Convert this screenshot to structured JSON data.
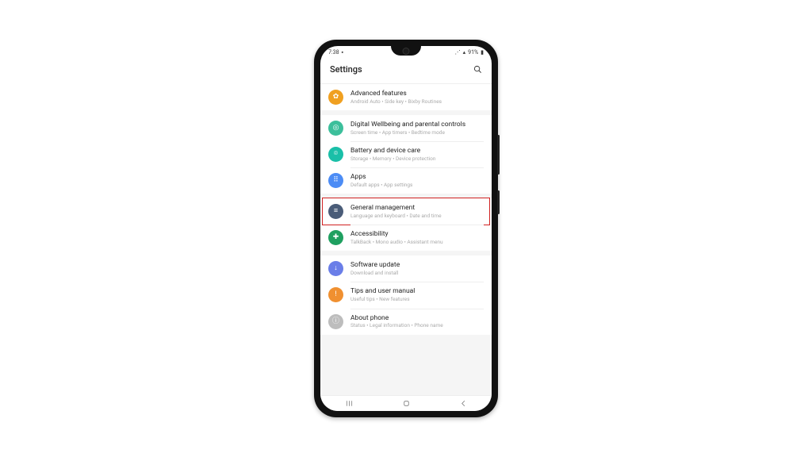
{
  "status": {
    "time": "7:38",
    "battery": "91%"
  },
  "header": {
    "title": "Settings"
  },
  "groups": [
    {
      "items": [
        {
          "title": "Advanced features",
          "subtitle": "Android Auto  •  Side key  •  Bixby Routines",
          "iconColor": "#f0a020",
          "iconGlyph": "✿"
        }
      ]
    },
    {
      "items": [
        {
          "title": "Digital Wellbeing and parental controls",
          "subtitle": "Screen time  •  App timers  •  Bedtime mode",
          "iconColor": "#3cbf9b",
          "iconGlyph": "◎"
        },
        {
          "title": "Battery and device care",
          "subtitle": "Storage  •  Memory  •  Device protection",
          "iconColor": "#1abfa8",
          "iconGlyph": "⌾"
        },
        {
          "title": "Apps",
          "subtitle": "Default apps  •  App settings",
          "iconColor": "#4c8cf5",
          "iconGlyph": "⠿"
        }
      ]
    },
    {
      "items": [
        {
          "title": "General management",
          "subtitle": "Language and keyboard  •  Date and time",
          "iconColor": "#4a5c78",
          "iconGlyph": "≡",
          "highlight": true
        },
        {
          "title": "Accessibility",
          "subtitle": "TalkBack  •  Mono audio  •  Assistant menu",
          "iconColor": "#1fa060",
          "iconGlyph": "✚"
        }
      ]
    },
    {
      "items": [
        {
          "title": "Software update",
          "subtitle": "Download and install",
          "iconColor": "#6a7ee8",
          "iconGlyph": "↓"
        },
        {
          "title": "Tips and user manual",
          "subtitle": "Useful tips  •  New features",
          "iconColor": "#f09030",
          "iconGlyph": "!"
        },
        {
          "title": "About phone",
          "subtitle": "Status  •  Legal information  •  Phone name",
          "iconColor": "#bdbdbd",
          "iconGlyph": "ⓘ"
        }
      ]
    }
  ]
}
